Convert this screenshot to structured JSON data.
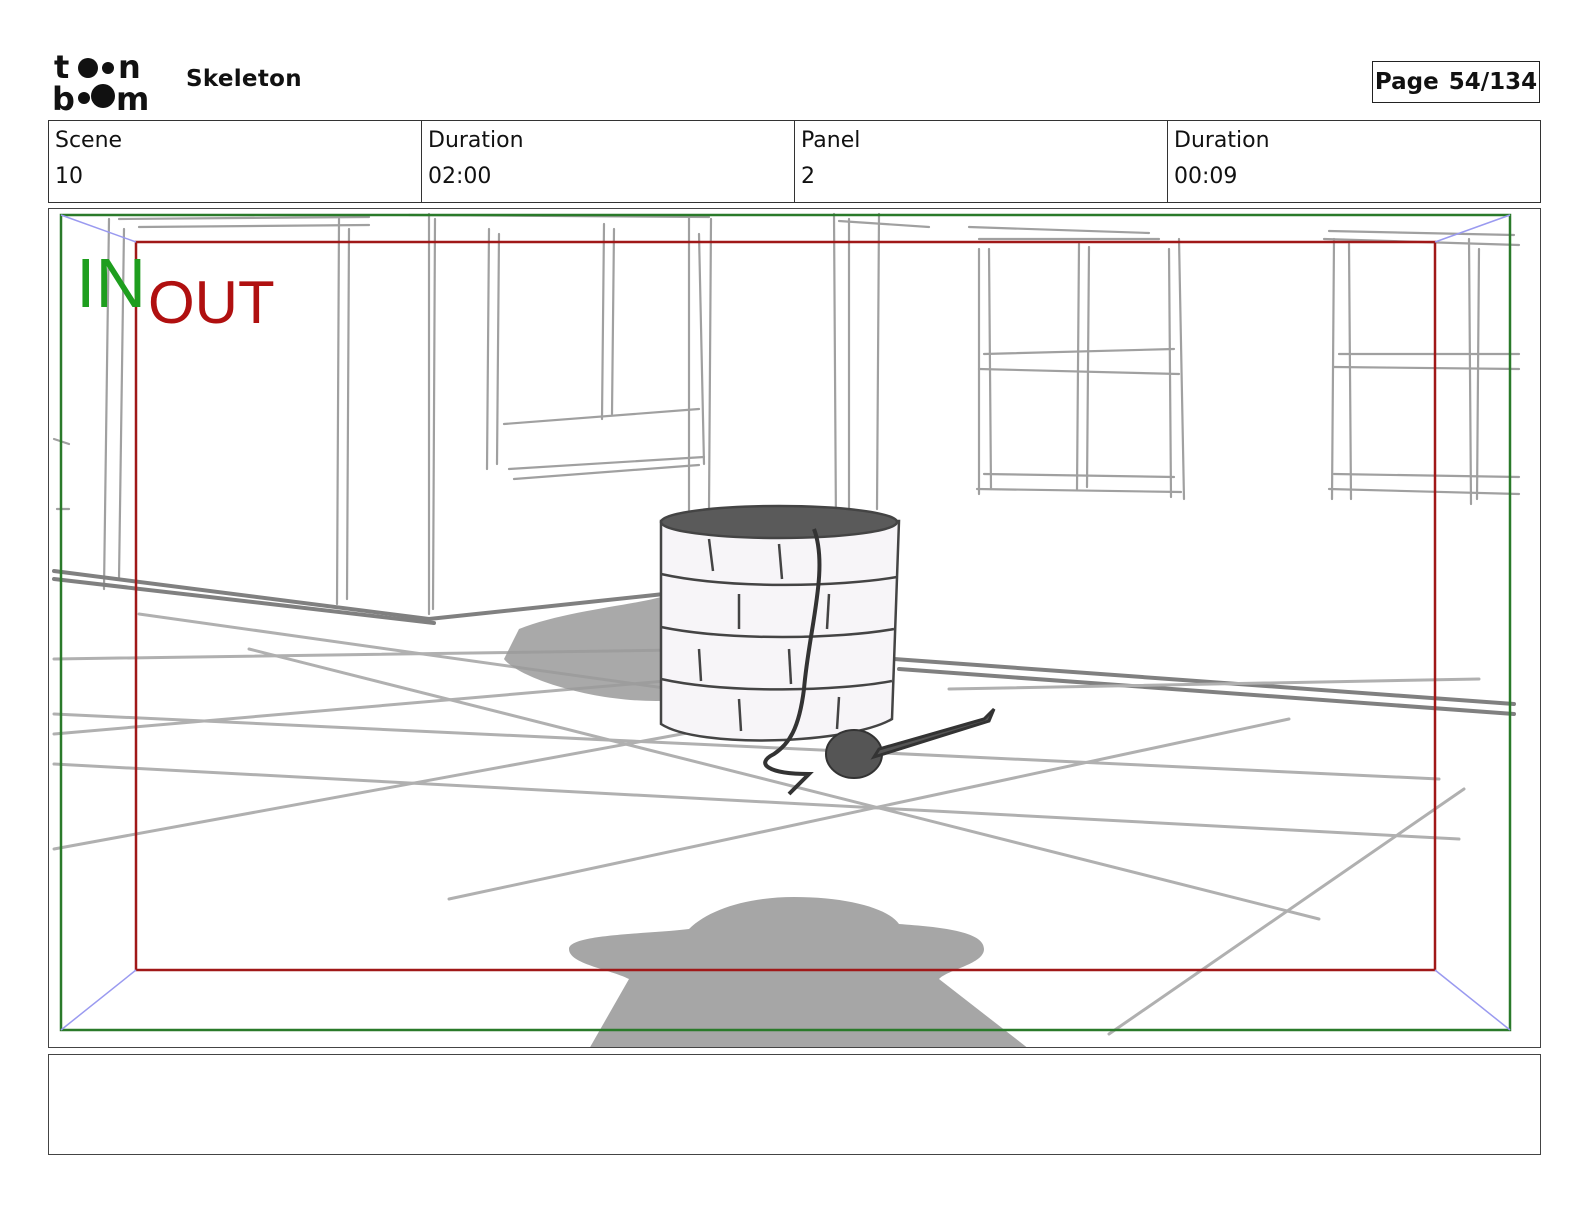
{
  "header": {
    "project_title": "Skeleton",
    "page_label": "Page",
    "page_number": "54/134"
  },
  "info": {
    "scene": {
      "label": "Scene",
      "value": "10"
    },
    "scene_duration": {
      "label": "Duration",
      "value": "02:00"
    },
    "panel": {
      "label": "Panel",
      "value": "2"
    },
    "panel_duration": {
      "label": "Duration",
      "value": "00:09"
    }
  },
  "panel_overlay": {
    "in_label": "IN",
    "out_label": "OUT",
    "colors": {
      "in": "#1e9e1e",
      "out": "#b01010",
      "frame_in": "#2a7a2a",
      "frame_out": "#a01818",
      "guides": "#9a9af0"
    }
  },
  "notes": {
    "text": ""
  }
}
